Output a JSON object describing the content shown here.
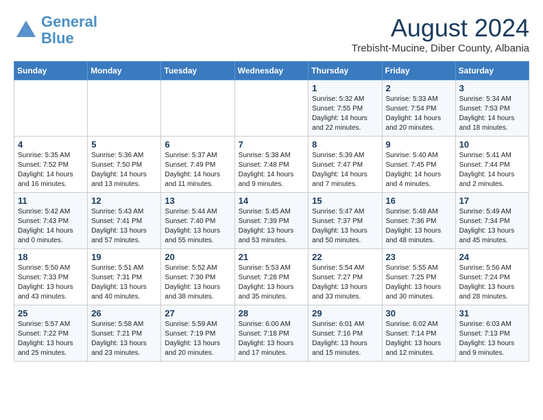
{
  "header": {
    "logo_line1": "General",
    "logo_line2": "Blue",
    "month_year": "August 2024",
    "location": "Trebisht-Mucine, Diber County, Albania"
  },
  "days_of_week": [
    "Sunday",
    "Monday",
    "Tuesday",
    "Wednesday",
    "Thursday",
    "Friday",
    "Saturday"
  ],
  "weeks": [
    [
      {
        "day": "",
        "info": ""
      },
      {
        "day": "",
        "info": ""
      },
      {
        "day": "",
        "info": ""
      },
      {
        "day": "",
        "info": ""
      },
      {
        "day": "1",
        "info": "Sunrise: 5:32 AM\nSunset: 7:55 PM\nDaylight: 14 hours\nand 22 minutes."
      },
      {
        "day": "2",
        "info": "Sunrise: 5:33 AM\nSunset: 7:54 PM\nDaylight: 14 hours\nand 20 minutes."
      },
      {
        "day": "3",
        "info": "Sunrise: 5:34 AM\nSunset: 7:53 PM\nDaylight: 14 hours\nand 18 minutes."
      }
    ],
    [
      {
        "day": "4",
        "info": "Sunrise: 5:35 AM\nSunset: 7:52 PM\nDaylight: 14 hours\nand 16 minutes."
      },
      {
        "day": "5",
        "info": "Sunrise: 5:36 AM\nSunset: 7:50 PM\nDaylight: 14 hours\nand 13 minutes."
      },
      {
        "day": "6",
        "info": "Sunrise: 5:37 AM\nSunset: 7:49 PM\nDaylight: 14 hours\nand 11 minutes."
      },
      {
        "day": "7",
        "info": "Sunrise: 5:38 AM\nSunset: 7:48 PM\nDaylight: 14 hours\nand 9 minutes."
      },
      {
        "day": "8",
        "info": "Sunrise: 5:39 AM\nSunset: 7:47 PM\nDaylight: 14 hours\nand 7 minutes."
      },
      {
        "day": "9",
        "info": "Sunrise: 5:40 AM\nSunset: 7:45 PM\nDaylight: 14 hours\nand 4 minutes."
      },
      {
        "day": "10",
        "info": "Sunrise: 5:41 AM\nSunset: 7:44 PM\nDaylight: 14 hours\nand 2 minutes."
      }
    ],
    [
      {
        "day": "11",
        "info": "Sunrise: 5:42 AM\nSunset: 7:43 PM\nDaylight: 14 hours\nand 0 minutes."
      },
      {
        "day": "12",
        "info": "Sunrise: 5:43 AM\nSunset: 7:41 PM\nDaylight: 13 hours\nand 57 minutes."
      },
      {
        "day": "13",
        "info": "Sunrise: 5:44 AM\nSunset: 7:40 PM\nDaylight: 13 hours\nand 55 minutes."
      },
      {
        "day": "14",
        "info": "Sunrise: 5:45 AM\nSunset: 7:39 PM\nDaylight: 13 hours\nand 53 minutes."
      },
      {
        "day": "15",
        "info": "Sunrise: 5:47 AM\nSunset: 7:37 PM\nDaylight: 13 hours\nand 50 minutes."
      },
      {
        "day": "16",
        "info": "Sunrise: 5:48 AM\nSunset: 7:36 PM\nDaylight: 13 hours\nand 48 minutes."
      },
      {
        "day": "17",
        "info": "Sunrise: 5:49 AM\nSunset: 7:34 PM\nDaylight: 13 hours\nand 45 minutes."
      }
    ],
    [
      {
        "day": "18",
        "info": "Sunrise: 5:50 AM\nSunset: 7:33 PM\nDaylight: 13 hours\nand 43 minutes."
      },
      {
        "day": "19",
        "info": "Sunrise: 5:51 AM\nSunset: 7:31 PM\nDaylight: 13 hours\nand 40 minutes."
      },
      {
        "day": "20",
        "info": "Sunrise: 5:52 AM\nSunset: 7:30 PM\nDaylight: 13 hours\nand 38 minutes."
      },
      {
        "day": "21",
        "info": "Sunrise: 5:53 AM\nSunset: 7:28 PM\nDaylight: 13 hours\nand 35 minutes."
      },
      {
        "day": "22",
        "info": "Sunrise: 5:54 AM\nSunset: 7:27 PM\nDaylight: 13 hours\nand 33 minutes."
      },
      {
        "day": "23",
        "info": "Sunrise: 5:55 AM\nSunset: 7:25 PM\nDaylight: 13 hours\nand 30 minutes."
      },
      {
        "day": "24",
        "info": "Sunrise: 5:56 AM\nSunset: 7:24 PM\nDaylight: 13 hours\nand 28 minutes."
      }
    ],
    [
      {
        "day": "25",
        "info": "Sunrise: 5:57 AM\nSunset: 7:22 PM\nDaylight: 13 hours\nand 25 minutes."
      },
      {
        "day": "26",
        "info": "Sunrise: 5:58 AM\nSunset: 7:21 PM\nDaylight: 13 hours\nand 23 minutes."
      },
      {
        "day": "27",
        "info": "Sunrise: 5:59 AM\nSunset: 7:19 PM\nDaylight: 13 hours\nand 20 minutes."
      },
      {
        "day": "28",
        "info": "Sunrise: 6:00 AM\nSunset: 7:18 PM\nDaylight: 13 hours\nand 17 minutes."
      },
      {
        "day": "29",
        "info": "Sunrise: 6:01 AM\nSunset: 7:16 PM\nDaylight: 13 hours\nand 15 minutes."
      },
      {
        "day": "30",
        "info": "Sunrise: 6:02 AM\nSunset: 7:14 PM\nDaylight: 13 hours\nand 12 minutes."
      },
      {
        "day": "31",
        "info": "Sunrise: 6:03 AM\nSunset: 7:13 PM\nDaylight: 13 hours\nand 9 minutes."
      }
    ]
  ]
}
